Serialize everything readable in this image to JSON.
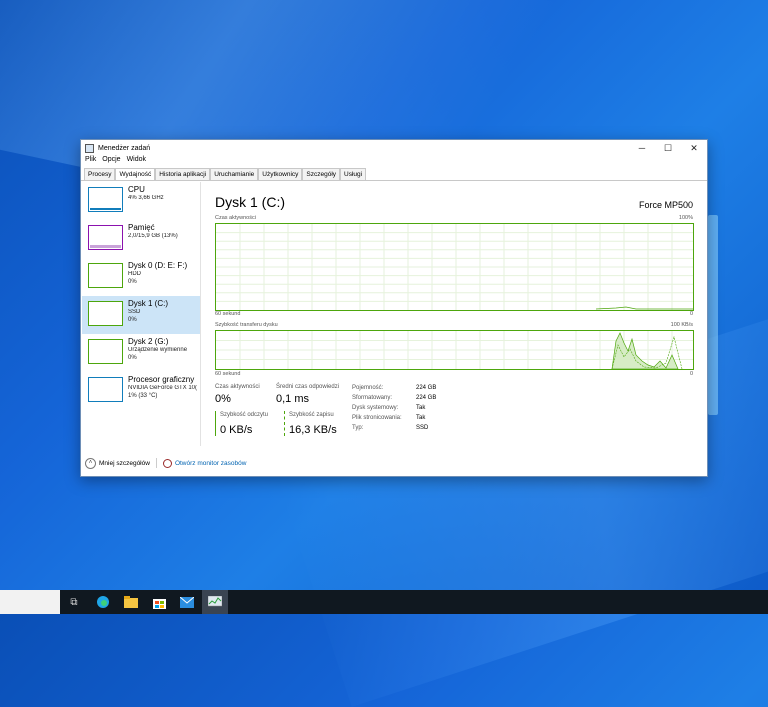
{
  "window": {
    "title": "Menedżer zadań"
  },
  "menu": [
    "Plik",
    "Opcje",
    "Widok"
  ],
  "tabs": [
    {
      "label": "Procesy"
    },
    {
      "label": "Wydajność",
      "active": true
    },
    {
      "label": "Historia aplikacji"
    },
    {
      "label": "Uruchamianie"
    },
    {
      "label": "Użytkownicy"
    },
    {
      "label": "Szczegóły"
    },
    {
      "label": "Usługi"
    }
  ],
  "sidebar": {
    "items": [
      {
        "name": "CPU",
        "sub": "4% 3,66 GHz",
        "sub2": ""
      },
      {
        "name": "Pamięć",
        "sub": "2,0/15,9 GB (13%)",
        "sub2": ""
      },
      {
        "name": "Dysk 0 (D: E: F:)",
        "sub": "HDD",
        "sub2": "0%"
      },
      {
        "name": "Dysk 1 (C:)",
        "sub": "SSD",
        "sub2": "0%"
      },
      {
        "name": "Dysk 2 (G:)",
        "sub": "Urządzenie wymienne",
        "sub2": "0%"
      },
      {
        "name": "Procesor graficzny",
        "sub": "NVIDIA GeForce GTX 10(",
        "sub2": "1% (33 °C)"
      }
    ]
  },
  "main": {
    "title": "Dysk 1 (C:)",
    "model": "Force MP500",
    "graph1": {
      "label": "Czas aktywności",
      "max": "100%",
      "time": "60 sekund",
      "min": "0"
    },
    "graph2": {
      "label": "Szybkość transferu dysku",
      "max": "100 KB/s",
      "time": "60 sekund",
      "min": "0"
    },
    "stats": {
      "active_label": "Czas aktywności",
      "active_value": "0%",
      "resp_label": "Średni czas odpowiedzi",
      "resp_value": "0,1 ms",
      "read_label": "Szybkość odczytu",
      "read_value": "0 KB/s",
      "write_label": "Szybkość zapisu",
      "write_value": "16,3 KB/s"
    },
    "props": [
      {
        "label": "Pojemność:",
        "value": "224 GB"
      },
      {
        "label": "Sformatowany:",
        "value": "224 GB"
      },
      {
        "label": "Dysk systemowy:",
        "value": "Tak"
      },
      {
        "label": "Plik stronicowania:",
        "value": "Tak"
      },
      {
        "label": "Typ:",
        "value": "SSD"
      }
    ]
  },
  "footer": {
    "less_details": "Mniej szczegółów",
    "open_monitor": "Otwórz monitor zasobów"
  },
  "colors": {
    "disk": "#4da60c",
    "cpu": "#117dbb",
    "memory": "#8b12ae"
  }
}
